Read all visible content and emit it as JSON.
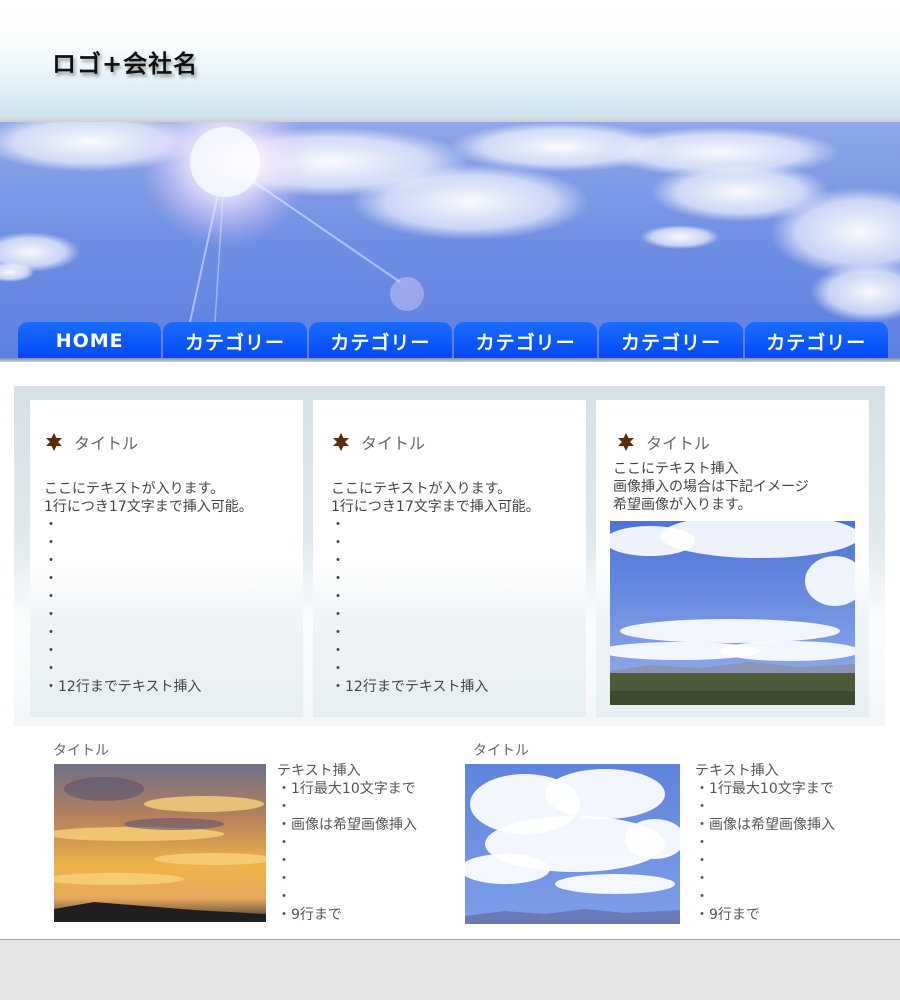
{
  "header": {
    "logo_text": "ロゴ+会社名"
  },
  "nav": {
    "items": [
      {
        "label": "HOME"
      },
      {
        "label": "カテゴリー"
      },
      {
        "label": "カテゴリー"
      },
      {
        "label": "カテゴリー"
      },
      {
        "label": "カテゴリー"
      },
      {
        "label": "カテゴリー"
      }
    ]
  },
  "cards": [
    {
      "title": "タイトル",
      "lines": [
        "ここにテキストが入ります。",
        "1行につき17文字まで挿入可能。",
        "・",
        "・",
        "・",
        "・",
        "・",
        "・",
        "・",
        "・",
        "・",
        "・12行までテキスト挿入"
      ]
    },
    {
      "title": "タイトル",
      "lines": [
        "ここにテキストが入ります。",
        "1行につき17文字まで挿入可能。",
        "・",
        "・",
        "・",
        "・",
        "・",
        "・",
        "・",
        "・",
        "・",
        "・12行までテキスト挿入"
      ]
    },
    {
      "title": "タイトル",
      "lines": [
        "ここにテキスト挿入",
        "画像挿入の場合は下記イメージ",
        "希望画像が入ります。"
      ]
    }
  ],
  "features": [
    {
      "title": "タイトル",
      "lines": [
        "テキスト挿入",
        "・1行最大10文字まで",
        "・",
        "・画像は希望画像挿入",
        "・",
        "・",
        "・",
        "・",
        "・9行まで"
      ]
    },
    {
      "title": "タイトル",
      "lines": [
        "テキスト挿入",
        "・1行最大10文字まで",
        "・",
        "・画像は希望画像挿入",
        "・",
        "・",
        "・",
        "・",
        "・9行まで"
      ]
    }
  ],
  "colors": {
    "nav_blue": "#0a55ff",
    "star": "#5a2e0c",
    "sky": "#4d7de0"
  }
}
